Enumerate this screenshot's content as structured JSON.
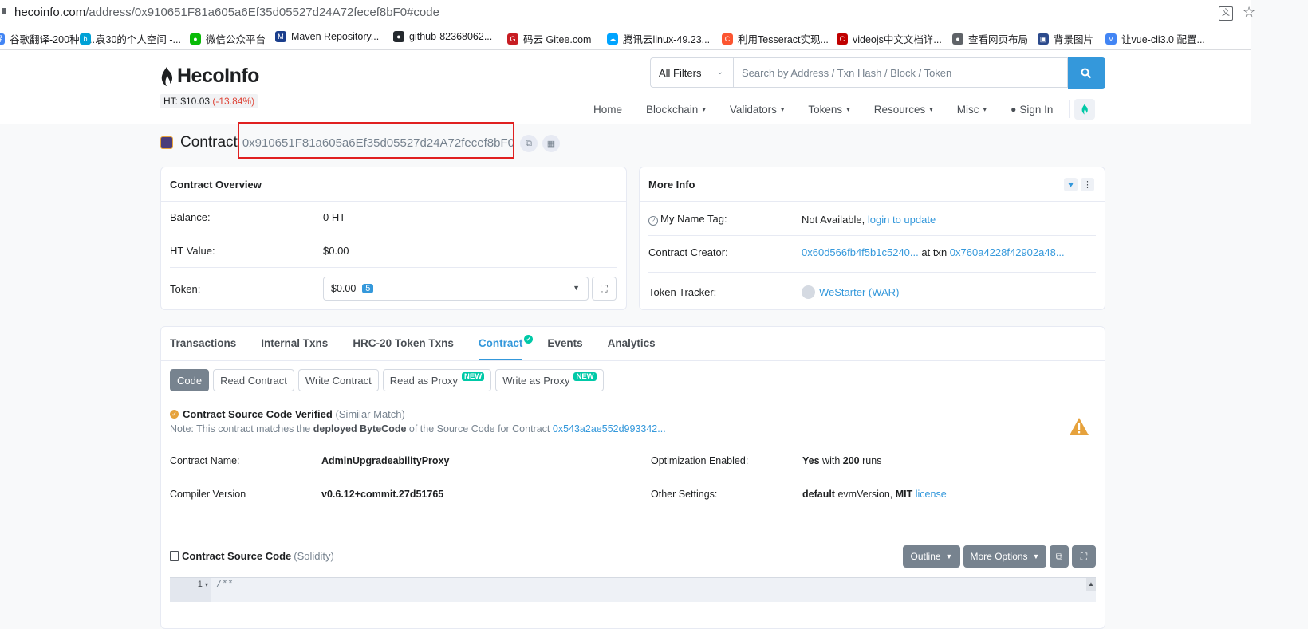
{
  "browser": {
    "url_host": "hecoinfo.com",
    "url_path": "/address/0x910651F81a605a6Ef35d05527d24A72fecef8bF0#code",
    "bookmarks": [
      {
        "label": "谷歌翻译-200种语...",
        "icon": "translate-icon",
        "color": "#4285f4"
      },
      {
        "label": "袁30的个人空间 -...",
        "icon": "bilibili-icon",
        "color": "#00a1d6"
      },
      {
        "label": "微信公众平台",
        "icon": "wechat-icon",
        "color": "#09bb07"
      },
      {
        "label": "Maven Repository...",
        "icon": "maven-icon",
        "color": "#1a3e8c"
      },
      {
        "label": "github-82368062...",
        "icon": "github-icon",
        "color": "#24292e"
      },
      {
        "label": "码云 Gitee.com",
        "icon": "gitee-icon",
        "color": "#c71d23"
      },
      {
        "label": "腾讯云linux-49.23...",
        "icon": "cloud-icon",
        "color": "#00a4ff"
      },
      {
        "label": "利用Tesseract实现...",
        "icon": "csdn-icon",
        "color": "#fc5531"
      },
      {
        "label": "videojs中文文档详...",
        "icon": "csdn-icon",
        "color": "#c00000"
      },
      {
        "label": "查看网页布局",
        "icon": "globe-icon",
        "color": "#5f6368"
      },
      {
        "label": "背景图片",
        "icon": "image-icon",
        "color": "#2c4a8c"
      },
      {
        "label": "让vue-cli3.0 配置...",
        "icon": "vue-icon",
        "color": "#4285f4"
      }
    ]
  },
  "header": {
    "logo": "HecoInfo",
    "price_label": "HT: $10.03",
    "price_change": "(-13.84%)",
    "filter": "All Filters",
    "search_placeholder": "Search by Address / Txn Hash / Block / Token",
    "nav": [
      "Home",
      "Blockchain",
      "Validators",
      "Tokens",
      "Resources",
      "Misc"
    ],
    "sign_in": "Sign In"
  },
  "page": {
    "title_label": "Contract",
    "address": "0x910651F81a605a6Ef35d05527d24A72fecef8bF0"
  },
  "overview": {
    "title": "Contract Overview",
    "balance_label": "Balance:",
    "balance": "0 HT",
    "ht_value_label": "HT Value:",
    "ht_value": "$0.00",
    "token_label": "Token:",
    "token_value": "$0.00",
    "token_count": "5"
  },
  "more_info": {
    "title": "More Info",
    "name_tag_label": "My Name Tag:",
    "name_tag_value": "Not Available,",
    "name_tag_link": "login to update",
    "creator_label": "Contract Creator:",
    "creator": "0x60d566fb4f5b1c5240...",
    "at_txn": "at txn",
    "creator_txn": "0x760a4228f42902a48...",
    "tracker_label": "Token Tracker:",
    "tracker": "WeStarter (WAR)"
  },
  "tabs": [
    "Transactions",
    "Internal Txns",
    "HRC-20 Token Txns",
    "Contract",
    "Events",
    "Analytics"
  ],
  "subtabs": {
    "code": "Code",
    "read": "Read Contract",
    "write": "Write Contract",
    "read_proxy": "Read as Proxy",
    "write_proxy": "Write as Proxy",
    "new_badge": "NEW"
  },
  "verification": {
    "title": "Contract Source Code Verified",
    "match": "(Similar Match)",
    "note_prefix": "Note: This contract matches the",
    "note_bold": "deployed ByteCode",
    "note_mid": "of the Source Code for Contract",
    "note_link": "0x543a2ae552d993342..."
  },
  "details": {
    "name_label": "Contract Name:",
    "name": "AdminUpgradeabilityProxy",
    "compiler_label": "Compiler Version",
    "compiler": "v0.6.12+commit.27d51765",
    "optimization_label": "Optimization Enabled:",
    "optimization_yes": "Yes",
    "optimization_with": "with",
    "optimization_runs": "200",
    "optimization_runs_word": "runs",
    "other_label": "Other Settings:",
    "other_default": "default",
    "other_evm": "evmVersion,",
    "other_mit": "MIT",
    "other_license": "license"
  },
  "source": {
    "title": "Contract Source Code",
    "lang": "(Solidity)",
    "outline": "Outline",
    "more_options": "More Options",
    "line_no": "1",
    "first_line": "/**"
  }
}
